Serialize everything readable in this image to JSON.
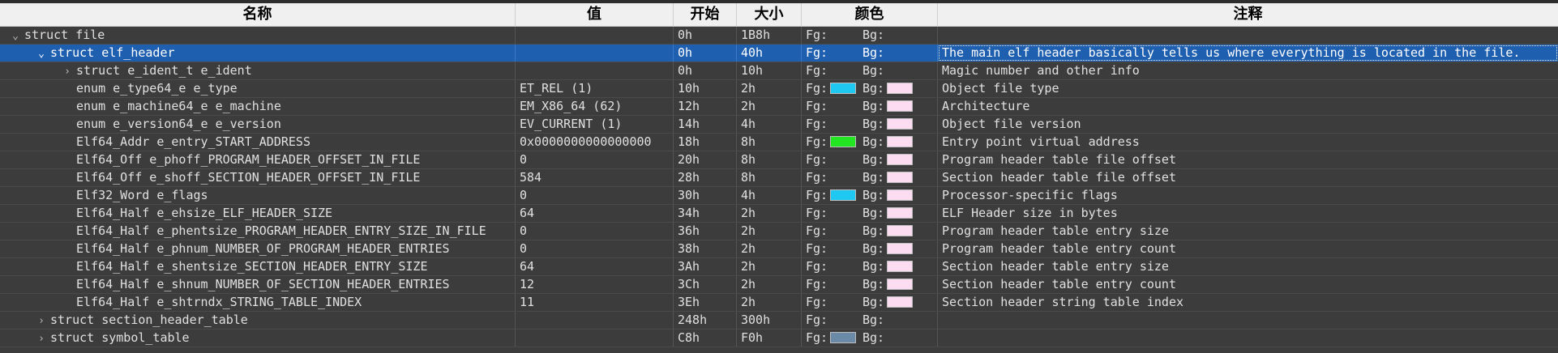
{
  "columns": {
    "name": "名称",
    "value": "值",
    "start": "开始",
    "size": "大小",
    "color": "颜色",
    "comment": "注释"
  },
  "labels": {
    "fg": "Fg:",
    "bg": "Bg:"
  },
  "colors": {
    "cyan": "#1ec8f0",
    "green": "#22e622",
    "pink": "#fbdcf0",
    "slate": "#6a8aa8",
    "selection": "#1f5fb0"
  },
  "rows": [
    {
      "name": "struct file",
      "value": "",
      "start": "0h",
      "size": "1B8h",
      "fg": "",
      "bg": "",
      "comment": "",
      "indent": 0,
      "expander": "expanded"
    },
    {
      "name": "struct elf_header",
      "value": "",
      "start": "0h",
      "size": "40h",
      "fg": "",
      "bg": "",
      "comment": "The main elf header basically tells us where everything is located in the file.",
      "indent": 1,
      "expander": "expanded",
      "selected": true
    },
    {
      "name": "struct e_ident_t e_ident",
      "value": "",
      "start": "0h",
      "size": "10h",
      "fg": "",
      "bg": "",
      "comment": "Magic number and other info",
      "indent": 2,
      "expander": "collapsed"
    },
    {
      "name": "enum e_type64_e e_type",
      "value": "ET_REL (1)",
      "start": "10h",
      "size": "2h",
      "fg": "cyan",
      "bg": "pink",
      "comment": "Object file type",
      "indent": 2,
      "expander": "none"
    },
    {
      "name": "enum e_machine64_e e_machine",
      "value": "EM_X86_64 (62)",
      "start": "12h",
      "size": "2h",
      "fg": "",
      "bg": "pink",
      "comment": "Architecture",
      "indent": 2,
      "expander": "none"
    },
    {
      "name": "enum e_version64_e e_version",
      "value": "EV_CURRENT (1)",
      "start": "14h",
      "size": "4h",
      "fg": "",
      "bg": "pink",
      "comment": "Object file version",
      "indent": 2,
      "expander": "none"
    },
    {
      "name": "Elf64_Addr e_entry_START_ADDRESS",
      "value": "0x0000000000000000",
      "start": "18h",
      "size": "8h",
      "fg": "green",
      "bg": "pink",
      "comment": "Entry point virtual address",
      "indent": 2,
      "expander": "none"
    },
    {
      "name": "Elf64_Off e_phoff_PROGRAM_HEADER_OFFSET_IN_FILE",
      "value": "0",
      "start": "20h",
      "size": "8h",
      "fg": "",
      "bg": "pink",
      "comment": "Program header table file offset",
      "indent": 2,
      "expander": "none"
    },
    {
      "name": "Elf64_Off e_shoff_SECTION_HEADER_OFFSET_IN_FILE",
      "value": "584",
      "start": "28h",
      "size": "8h",
      "fg": "",
      "bg": "pink",
      "comment": "Section header table file offset",
      "indent": 2,
      "expander": "none"
    },
    {
      "name": "Elf32_Word e_flags",
      "value": "0",
      "start": "30h",
      "size": "4h",
      "fg": "cyan",
      "bg": "pink",
      "comment": "Processor-specific flags",
      "indent": 2,
      "expander": "none"
    },
    {
      "name": "Elf64_Half e_ehsize_ELF_HEADER_SIZE",
      "value": "64",
      "start": "34h",
      "size": "2h",
      "fg": "",
      "bg": "pink",
      "comment": "ELF Header size in bytes",
      "indent": 2,
      "expander": "none"
    },
    {
      "name": "Elf64_Half e_phentsize_PROGRAM_HEADER_ENTRY_SIZE_IN_FILE",
      "value": "0",
      "start": "36h",
      "size": "2h",
      "fg": "",
      "bg": "pink",
      "comment": "Program header table entry size",
      "indent": 2,
      "expander": "none"
    },
    {
      "name": "Elf64_Half e_phnum_NUMBER_OF_PROGRAM_HEADER_ENTRIES",
      "value": "0",
      "start": "38h",
      "size": "2h",
      "fg": "",
      "bg": "pink",
      "comment": "Program header table entry count",
      "indent": 2,
      "expander": "none"
    },
    {
      "name": "Elf64_Half e_shentsize_SECTION_HEADER_ENTRY_SIZE",
      "value": "64",
      "start": "3Ah",
      "size": "2h",
      "fg": "",
      "bg": "pink",
      "comment": "Section header table entry size",
      "indent": 2,
      "expander": "none"
    },
    {
      "name": "Elf64_Half e_shnum_NUMBER_OF_SECTION_HEADER_ENTRIES",
      "value": "12",
      "start": "3Ch",
      "size": "2h",
      "fg": "",
      "bg": "pink",
      "comment": "Section header table entry count",
      "indent": 2,
      "expander": "none"
    },
    {
      "name": "Elf64_Half e_shtrndx_STRING_TABLE_INDEX",
      "value": "11",
      "start": "3Eh",
      "size": "2h",
      "fg": "",
      "bg": "pink",
      "comment": "Section header string table index",
      "indent": 2,
      "expander": "none"
    },
    {
      "name": "struct section_header_table",
      "value": "",
      "start": "248h",
      "size": "300h",
      "fg": "",
      "bg": "",
      "comment": "",
      "indent": 1,
      "expander": "collapsed"
    },
    {
      "name": "struct symbol_table",
      "value": "",
      "start": "C8h",
      "size": "F0h",
      "fg": "slate",
      "bg": "",
      "comment": "",
      "indent": 1,
      "expander": "collapsed"
    }
  ]
}
